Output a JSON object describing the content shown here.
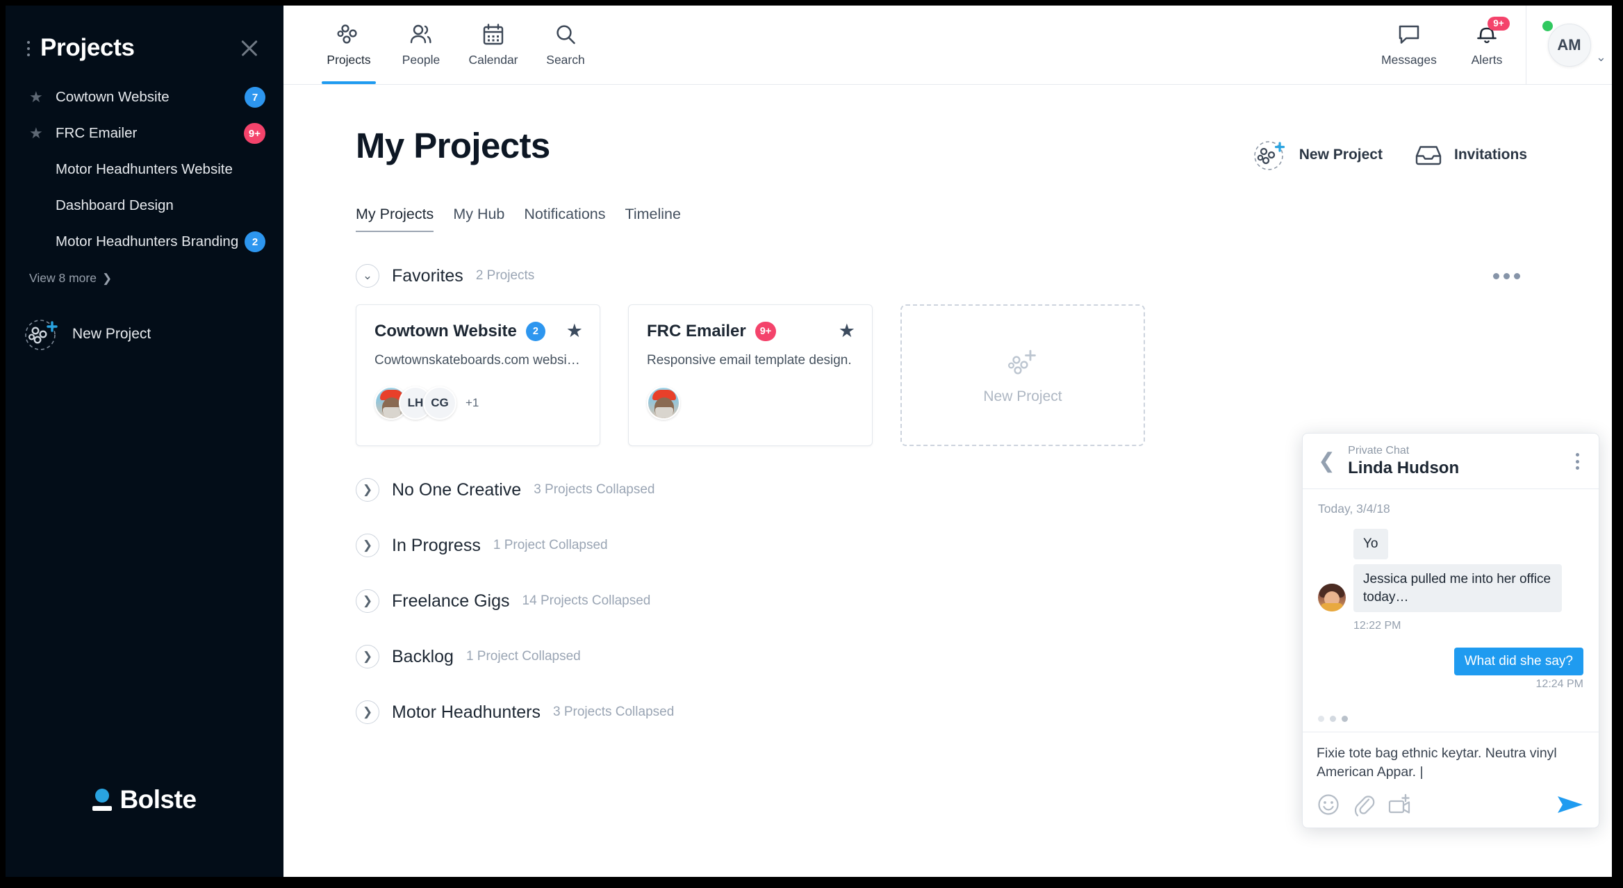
{
  "sidebar": {
    "title": "Projects",
    "close_icon": "close-icon",
    "grip_icon": "drag-handle-icon",
    "items": [
      {
        "label": "Cowtown Website",
        "badge": "7",
        "badge_color": "#2d96ef",
        "starred": true
      },
      {
        "label": "FRC Emailer",
        "badge": "9+",
        "badge_color": "#f4436b",
        "starred": true
      },
      {
        "label": "Motor Headhunters Website",
        "badge": "",
        "starred": false
      },
      {
        "label": "Dashboard Design",
        "badge": "",
        "starred": false
      },
      {
        "label": "Motor Headhunters Branding",
        "badge": "2",
        "badge_color": "#2d96ef",
        "starred": false
      }
    ],
    "view_more": "View 8 more",
    "new_project": "New Project",
    "brand": "Bolste"
  },
  "topbar": {
    "nav": [
      {
        "label": "Projects",
        "icon": "projects-dots-icon",
        "active": true
      },
      {
        "label": "People",
        "icon": "people-icon",
        "active": false
      },
      {
        "label": "Calendar",
        "icon": "calendar-icon",
        "active": false
      },
      {
        "label": "Search",
        "icon": "search-icon",
        "active": false
      }
    ],
    "messages": {
      "label": "Messages",
      "icon": "chat-bubble-icon"
    },
    "alerts": {
      "label": "Alerts",
      "icon": "bell-icon",
      "badge": "9+"
    },
    "user": {
      "initials": "AM",
      "status": "online",
      "chevron": "chevron-down-icon"
    }
  },
  "main": {
    "title": "My Projects",
    "actions": [
      {
        "label": "New Project",
        "icon": "new-project-icon"
      },
      {
        "label": "Invitations",
        "icon": "inbox-icon"
      }
    ],
    "tabs": [
      {
        "label": "My Projects",
        "active": true
      },
      {
        "label": "My Hub",
        "active": false
      },
      {
        "label": "Notifications",
        "active": false
      },
      {
        "label": "Timeline",
        "active": false
      }
    ],
    "favorites": {
      "name": "Favorites",
      "count": "2 Projects",
      "expanded": true,
      "cards": [
        {
          "title": "Cowtown Website",
          "badge": "2",
          "badge_color": "#2d96ef",
          "desc": "Cowtownskateboards.com website…",
          "starred": true,
          "avatars": [
            "",
            "LH",
            "CG"
          ],
          "avatar_more": "+1"
        },
        {
          "title": "FRC Emailer",
          "badge": "9+",
          "badge_color": "#f4436b",
          "desc": "Responsive email template design.",
          "starred": true,
          "avatars": [
            ""
          ],
          "avatar_more": ""
        }
      ],
      "new_card": "New Project"
    },
    "groups": [
      {
        "name": "No One Creative",
        "count": "3 Projects Collapsed"
      },
      {
        "name": "In Progress",
        "count": "1 Project Collapsed"
      },
      {
        "name": "Freelance Gigs",
        "count": "14 Projects Collapsed"
      },
      {
        "name": "Backlog",
        "count": "1 Project Collapsed"
      },
      {
        "name": "Motor Headhunters",
        "count": "3 Projects Collapsed"
      }
    ]
  },
  "chat": {
    "close_icon": "close-icon",
    "back_icon": "chevron-left-icon",
    "subtitle": "Private Chat",
    "name": "Linda Hudson",
    "kebab_icon": "more-vertical-icon",
    "date": "Today, 3/4/18",
    "messages": [
      {
        "from": "them",
        "text": "Yo"
      },
      {
        "from": "them",
        "text": "Jessica pulled me into her office today…",
        "time": "12:22 PM"
      },
      {
        "from": "me",
        "text": "What did she say?",
        "time": "12:24 PM"
      }
    ],
    "typing_indicator": true,
    "draft": "Fixie tote bag ethnic keytar. Neutra vinyl American Appar. |",
    "tools": [
      {
        "icon": "emoji-icon"
      },
      {
        "icon": "paperclip-icon"
      },
      {
        "icon": "video-add-icon"
      }
    ],
    "send_icon": "send-icon",
    "accent": "#1f9bf0"
  }
}
